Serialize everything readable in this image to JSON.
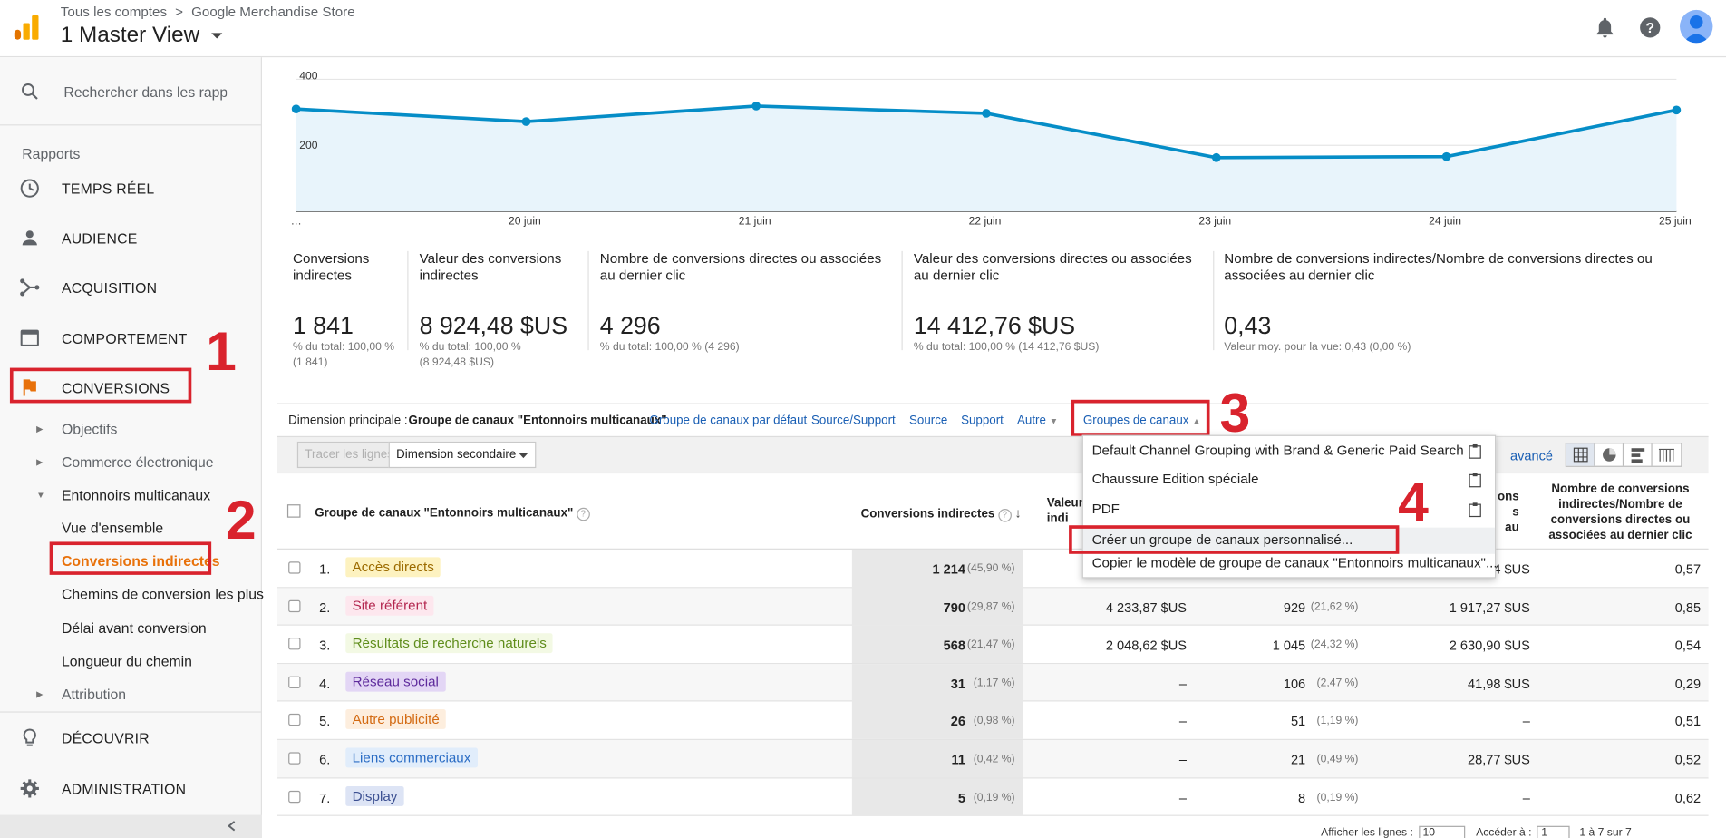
{
  "header": {
    "breadcrumb_account": "Tous les comptes",
    "breadcrumb_sep": ">",
    "breadcrumb_property": "Google Merchandise Store",
    "view_title": "1 Master View"
  },
  "sidebar": {
    "search_placeholder": "Rechercher dans les rappor",
    "section_label": "Rapports",
    "items": {
      "realtime": "TEMPS RÉEL",
      "audience": "AUDIENCE",
      "acquisition": "ACQUISITION",
      "behavior": "COMPORTEMENT",
      "conversions": "CONVERSIONS",
      "discover": "DÉCOUVRIR",
      "admin": "ADMINISTRATION"
    },
    "sub": {
      "goals": "Objectifs",
      "ecommerce": "Commerce électronique",
      "mcf": "Entonnoirs multicanaux",
      "overview": "Vue d'ensemble",
      "assisted": "Conversions indirectes",
      "top_paths": "Chemins de conversion les plus",
      "time_lag": "Délai avant conversion",
      "path_length": "Longueur du chemin",
      "attribution": "Attribution"
    }
  },
  "annotations": {
    "n1": "1",
    "n2": "2",
    "n3": "3",
    "n4": "4"
  },
  "chart_data": {
    "type": "area",
    "x": [
      "…",
      "20 juin",
      "21 juin",
      "22 juin",
      "23 juin",
      "24 juin",
      "25 juin"
    ],
    "values": [
      310,
      272,
      319,
      297,
      163,
      166,
      307
    ],
    "y_ticks": [
      "400",
      "200"
    ],
    "ylim": [
      0,
      420
    ],
    "color": "#058dc7",
    "fill": "#e8f4fb"
  },
  "metrics": [
    {
      "title": "Conversions indirectes",
      "value": "1 841",
      "sub1": "% du total: 100,00 %",
      "sub2": "(1 841)"
    },
    {
      "title": "Valeur des conversions indirectes",
      "value": "8 924,48 $US",
      "sub1": "% du total: 100,00 %",
      "sub2": "(8 924,48 $US)"
    },
    {
      "title": "Nombre de conversions directes ou associées au dernier clic",
      "value": "4 296",
      "sub1": "% du total: 100,00 % (4 296)",
      "sub2": ""
    },
    {
      "title": "Valeur des conversions directes ou associées au dernier clic",
      "value": "14 412,76 $US",
      "sub1": "% du total: 100,00 % (14 412,76 $US)",
      "sub2": ""
    },
    {
      "title": "Nombre de conversions indirectes/Nombre de conversions directes ou associées au dernier clic",
      "value": "0,43",
      "sub1": "Valeur moy. pour la vue: 0,43 (0,00 %)",
      "sub2": ""
    }
  ],
  "dimension_bar": {
    "label": "Dimension principale :",
    "active": "Groupe de canaux \"Entonnoirs multicanaux\"",
    "links": [
      "Groupe de canaux par défaut",
      "Source/Support",
      "Source",
      "Support",
      "Autre"
    ],
    "groups": "Groupes de canaux"
  },
  "toolbar": {
    "plot_rows": "Tracer les lignes",
    "secondary": "Dimension secondaire",
    "advanced": "avancé"
  },
  "dropdown": {
    "items": [
      "Default Channel Grouping with Brand & Generic Paid Search",
      "Chaussure Edition spéciale",
      "PDF",
      "Créer un groupe de canaux personnalisé...",
      "Copier le modèle de groupe de canaux \"Entonnoirs multicanaux\"..."
    ]
  },
  "table": {
    "headers": {
      "dim": "Groupe de canaux \"Entonnoirs multicanaux\"",
      "c1": "Conversions indirectes",
      "c2a": "Valeur",
      "c2b": "indi",
      "c4a": "ons",
      "c4b": "s au",
      "c5": "Nombre de conversions indirectes/Nombre de conversions directes ou associées au dernier clic"
    },
    "rows": [
      {
        "idx": "1.",
        "name": "Accès directs",
        "bg": "#fdf2c0",
        "fg": "#9c6b00",
        "c1": "1 214",
        "p1": "(45,90 %)",
        "c2": "",
        "c3": "",
        "p3": "",
        "c4": "4 $US",
        "c5": "0,57"
      },
      {
        "idx": "2.",
        "name": "Site référent",
        "bg": "#fde7ee",
        "fg": "#b3264f",
        "c1": "790",
        "p1": "(29,87 %)",
        "c2": "4 233,87 $US",
        "c3": "929",
        "p3": "(21,62 %)",
        "c4": "1 917,27 $US",
        "c5": "0,85"
      },
      {
        "idx": "3.",
        "name": "Résultats de recherche naturels",
        "bg": "#f3f9e4",
        "fg": "#5f8d1b",
        "c1": "568",
        "p1": "(21,47 %)",
        "c2": "2 048,62 $US",
        "c3": "1 045",
        "p3": "(24,32 %)",
        "c4": "2 630,90 $US",
        "c5": "0,54"
      },
      {
        "idx": "4.",
        "name": "Réseau social",
        "bg": "#e3d6f5",
        "fg": "#5e2a9c",
        "c1": "31",
        "p1": "(1,17 %)",
        "c2": "–",
        "c3": "106",
        "p3": "(2,47 %)",
        "c4": "41,98 $US",
        "c5": "0,29"
      },
      {
        "idx": "5.",
        "name": "Autre publicité",
        "bg": "#fdeede",
        "fg": "#d36a12",
        "c1": "26",
        "p1": "(0,98 %)",
        "c2": "–",
        "c3": "51",
        "p3": "(1,19 %)",
        "c4": "–",
        "c5": "0,51"
      },
      {
        "idx": "6.",
        "name": "Liens commerciaux",
        "bg": "#e1edfb",
        "fg": "#2a6cc4",
        "c1": "11",
        "p1": "(0,42 %)",
        "c2": "–",
        "c3": "21",
        "p3": "(0,49 %)",
        "c4": "28,77 $US",
        "c5": "0,52"
      },
      {
        "idx": "7.",
        "name": "Display",
        "bg": "#dde4f5",
        "fg": "#3b4f91",
        "c1": "5",
        "p1": "(0,19 %)",
        "c2": "–",
        "c3": "8",
        "p3": "(0,19 %)",
        "c4": "–",
        "c5": "0,62"
      }
    ]
  },
  "pager": {
    "show_rows": "Afficher les lignes :",
    "rows_value": "10",
    "goto": "Accéder à :",
    "goto_value": "1",
    "range": "1 à 7 sur 7"
  }
}
